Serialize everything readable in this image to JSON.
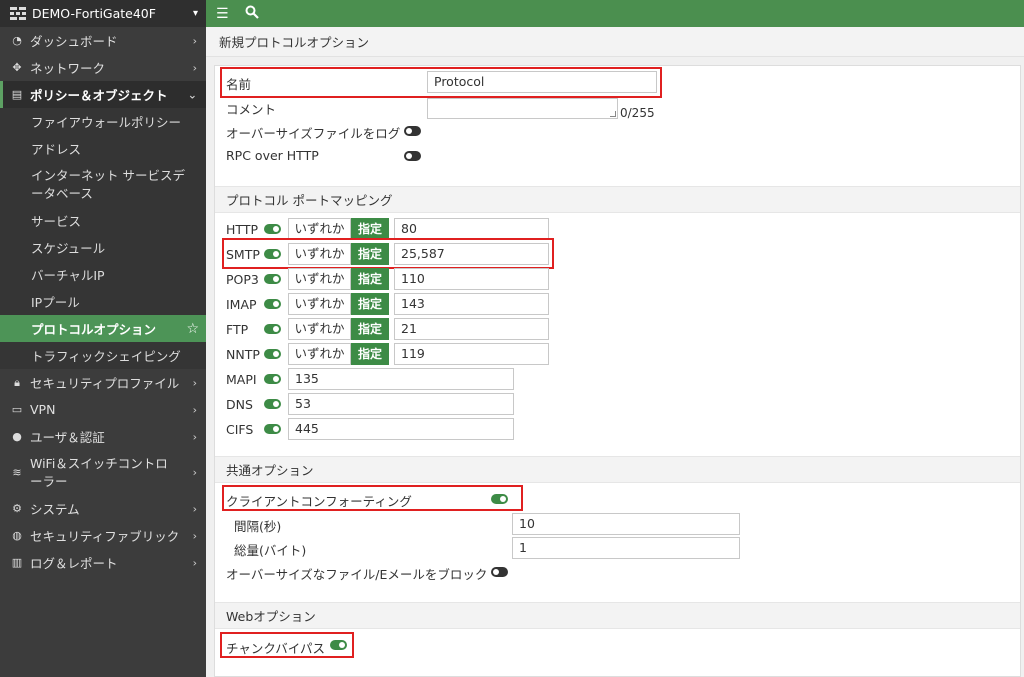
{
  "sidebar": {
    "device": "DEMO-FortiGate40F",
    "items": [
      {
        "label": "ダッシュボード"
      },
      {
        "label": "ネットワーク"
      },
      {
        "label": "ポリシー＆オブジェクト"
      },
      {
        "label": "セキュリティプロファイル"
      },
      {
        "label": "VPN"
      },
      {
        "label": "ユーザ＆認証"
      },
      {
        "label": "WiFi＆スイッチコントローラー"
      },
      {
        "label": "システム"
      },
      {
        "label": "セキュリティファブリック"
      },
      {
        "label": "ログ＆レポート"
      }
    ],
    "subitems": [
      {
        "label": "ファイアウォールポリシー"
      },
      {
        "label": "アドレス"
      },
      {
        "label": "インターネット サービスデータベース"
      },
      {
        "label": "サービス"
      },
      {
        "label": "スケジュール"
      },
      {
        "label": "バーチャルIP"
      },
      {
        "label": "IPプール"
      },
      {
        "label": "プロトコルオプション"
      },
      {
        "label": "トラフィックシェイピング"
      }
    ]
  },
  "page": {
    "title": "新規プロトコルオプション"
  },
  "form": {
    "name_label": "名前",
    "name_value": "Protocol",
    "comment_label": "コメント",
    "comment_count": "0/255",
    "oversize_log_label": "オーバーサイズファイルをログ",
    "rpc_label": "RPC over HTTP"
  },
  "port_mapping": {
    "section_title": "プロトコル ポートマッピング",
    "any_label": "いずれか",
    "specify_label": "指定",
    "rows": [
      {
        "protocol": "HTTP",
        "ports": "80"
      },
      {
        "protocol": "SMTP",
        "ports": "25,587"
      },
      {
        "protocol": "POP3",
        "ports": "110"
      },
      {
        "protocol": "IMAP",
        "ports": "143"
      },
      {
        "protocol": "FTP",
        "ports": "21"
      },
      {
        "protocol": "NNTP",
        "ports": "119"
      },
      {
        "protocol": "MAPI",
        "ports": "135"
      },
      {
        "protocol": "DNS",
        "ports": "53"
      },
      {
        "protocol": "CIFS",
        "ports": "445"
      }
    ]
  },
  "common": {
    "section_title": "共通オプション",
    "client_comforting_label": "クライアントコンフォーティング",
    "interval_label": "間隔(秒)",
    "interval_value": "10",
    "amount_label": "総量(バイト)",
    "amount_value": "1",
    "block_oversize_label": "オーバーサイズなファイル/Eメールをブロック"
  },
  "web": {
    "section_title": "Webオプション",
    "chunk_bypass_label": "チャンクバイパス"
  },
  "colors": {
    "accent": "#4b8f4f",
    "highlight": "#e02020"
  }
}
